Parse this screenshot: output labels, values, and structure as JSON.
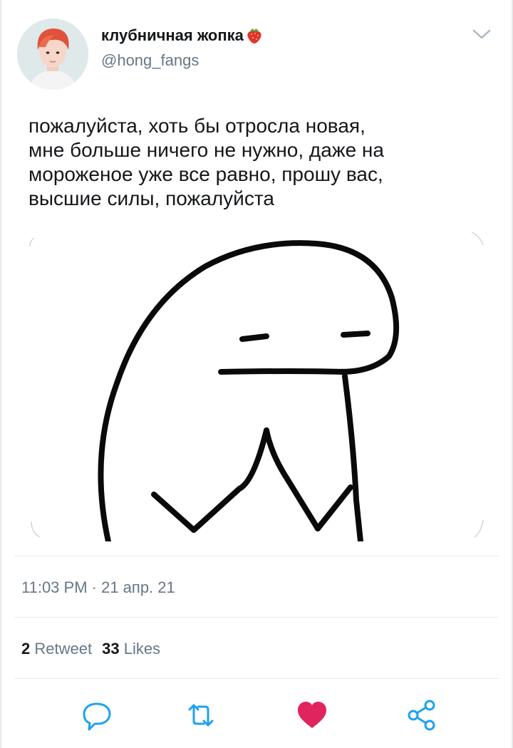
{
  "tweet": {
    "author_name": "клубничная жопка",
    "author_emoji_icon": "strawberry-icon",
    "author_handle": "@hong_fangs",
    "text": "пожалуйста, хоть бы отросла новая,\nмне больше ничего не нужно, даже на\nмороженое уже все равно, прошу вас,\nвысшие силы, пожалуйста",
    "timestamp": "11:03 PM · 21 апр. 21",
    "retweets_count": "2",
    "retweets_label": "Retweet",
    "likes_count": "33",
    "likes_label": "Likes",
    "liked": true
  },
  "actions": {
    "reply_icon": "reply-icon",
    "retweet_icon": "retweet-icon",
    "like_icon": "heart-icon",
    "share_icon": "share-icon"
  },
  "colors": {
    "text": "#14171a",
    "secondary": "#657786",
    "divider": "#e6ecf0",
    "like": "#e0245e",
    "icon": "#1da1f2"
  }
}
